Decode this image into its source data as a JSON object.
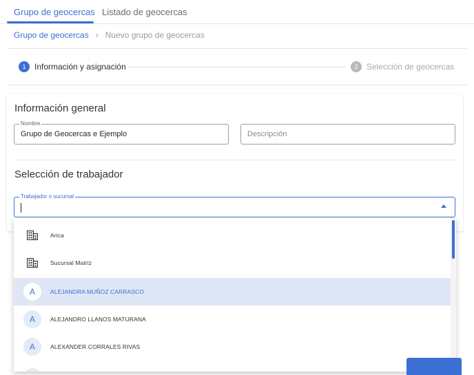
{
  "tabs": [
    {
      "label": "Grupo de geocercas",
      "active": true
    },
    {
      "label": "Listado de geocercas",
      "active": false
    }
  ],
  "breadcrumb": {
    "parent": "Grupo de geocercas",
    "separator": "›",
    "current": "Nuevo grupo de geocercas"
  },
  "stepper": {
    "steps": [
      {
        "number": "1",
        "label": "Información y asignación",
        "active": true
      },
      {
        "number": "2",
        "label": "Selección de geocercas",
        "active": false
      }
    ]
  },
  "form": {
    "section_info_title": "Información general",
    "name_legend": "Nombre",
    "name_value": "Grupo de Geocercas e Ejemplo",
    "description_placeholder": "Descripción",
    "section_worker_title": "Selección de trabajador",
    "worker_legend": "Trabajador o sucursal",
    "worker_value": ""
  },
  "dropdown": {
    "options": [
      {
        "type": "branch",
        "label": "Arica",
        "icon": "building-icon",
        "selected": false
      },
      {
        "type": "branch",
        "label": "Sucursal Matriz",
        "icon": "building-icon",
        "selected": false
      },
      {
        "type": "worker",
        "label": "ALEJANDRA MUÑOZ CARRASCO",
        "avatar": "A",
        "selected": true
      },
      {
        "type": "worker",
        "label": "ALEJANDRO LLANOS MATURANA",
        "avatar": "A",
        "selected": false
      },
      {
        "type": "worker",
        "label": "ALEXANDER CORRALES RIVAS",
        "avatar": "A",
        "selected": false
      },
      {
        "type": "worker",
        "label": "",
        "avatar": "A",
        "selected": false
      }
    ]
  },
  "colors": {
    "primary": "#3b6fd4",
    "selected_bg": "#dfe6f5"
  }
}
